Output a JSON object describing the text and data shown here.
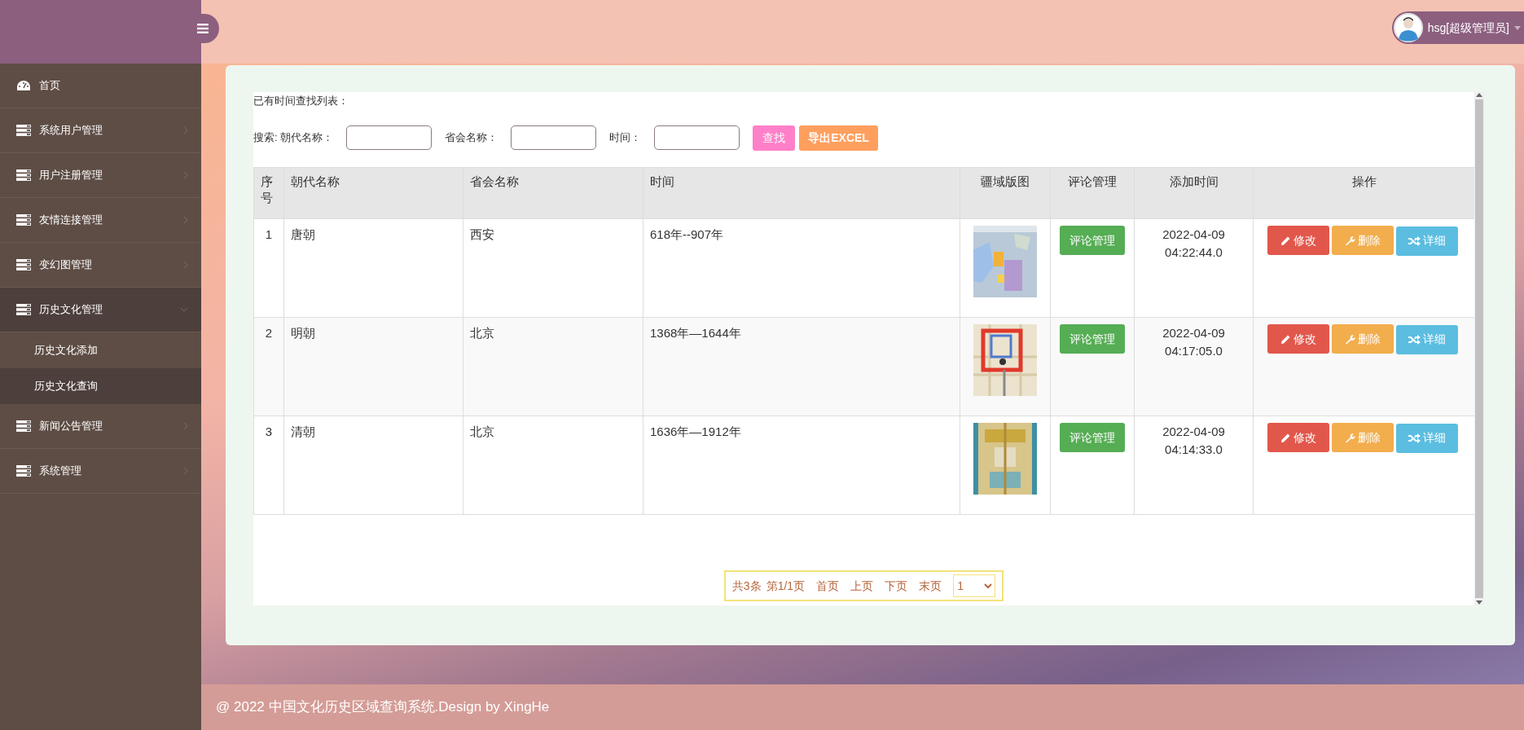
{
  "sidebar": {
    "items": [
      {
        "kind": "home",
        "label": "首页"
      },
      {
        "kind": "group",
        "label": "系统用户管理",
        "expanded": false
      },
      {
        "kind": "group",
        "label": "用户注册管理",
        "expanded": false
      },
      {
        "kind": "group",
        "label": "友情连接管理",
        "expanded": false
      },
      {
        "kind": "group",
        "label": "变幻图管理",
        "expanded": false
      },
      {
        "kind": "group",
        "label": "历史文化管理",
        "expanded": true,
        "children": [
          {
            "label": "历史文化添加",
            "hovered": true
          },
          {
            "label": "历史文化查询",
            "hovered": false
          }
        ]
      },
      {
        "kind": "group",
        "label": "新闻公告管理",
        "expanded": false
      },
      {
        "kind": "group",
        "label": "系统管理",
        "expanded": false
      }
    ]
  },
  "user": {
    "name": "hsg[超级管理员]"
  },
  "panel": {
    "title": "已有时间查找列表：",
    "search_fields": [
      {
        "label": "搜索: 朝代名称："
      },
      {
        "label": "省会名称："
      },
      {
        "label": "时间："
      }
    ],
    "buttons": [
      {
        "kind": "search",
        "label": "查找"
      },
      {
        "kind": "export",
        "label": "导出EXCEL"
      }
    ]
  },
  "table": {
    "columns": [
      "序号",
      "朝代名称",
      "省会名称",
      "时间",
      "疆域版图",
      "评论管理",
      "添加时间",
      "操作"
    ],
    "rows": [
      {
        "index": "1",
        "dynasty": "唐朝",
        "capital": "西安",
        "period": "618年--907年",
        "map": {
          "kind": "picture"
        },
        "comment_button": "评论管理",
        "added": "2022-04-09 04:22:44.0",
        "actions": [
          {
            "kind": "edit",
            "label": "修改"
          },
          {
            "kind": "delete",
            "label": "删除"
          },
          {
            "kind": "detail",
            "label": "详细"
          }
        ]
      },
      {
        "index": "2",
        "dynasty": "明朝",
        "capital": "北京",
        "period": "1368年—1644年",
        "map": {
          "kind": "picture"
        },
        "comment_button": "评论管理",
        "added": "2022-04-09 04:17:05.0",
        "actions": [
          {
            "kind": "edit",
            "label": "修改"
          },
          {
            "kind": "delete",
            "label": "删除"
          },
          {
            "kind": "detail",
            "label": "详细"
          }
        ]
      },
      {
        "index": "3",
        "dynasty": "清朝",
        "capital": "北京",
        "period": "1636年—1912年",
        "map": {
          "kind": "picture"
        },
        "comment_button": "评论管理",
        "added": "2022-04-09 04:14:33.0",
        "actions": [
          {
            "kind": "edit",
            "label": "修改"
          },
          {
            "kind": "delete",
            "label": "删除"
          },
          {
            "kind": "detail",
            "label": "详细"
          }
        ]
      }
    ]
  },
  "pagination": {
    "total": "共3条",
    "page": "第1/1页",
    "links": [
      "首页",
      "上页",
      "下页",
      "末页"
    ],
    "page_select": "1"
  },
  "footer": {
    "text": "@ 2022 中国文化历史区域查询系统.Design by XingHe"
  }
}
